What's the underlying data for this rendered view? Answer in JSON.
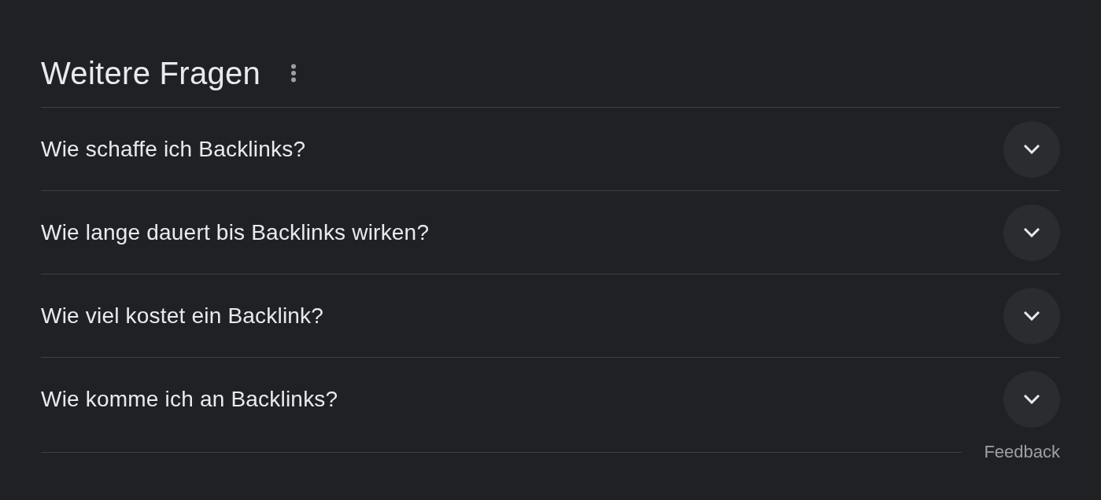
{
  "heading": {
    "title": "Weitere Fragen"
  },
  "questions": [
    {
      "text": "Wie schaffe ich Backlinks?",
      "expanded": false
    },
    {
      "text": "Wie lange dauert bis Backlinks wirken?",
      "expanded": false
    },
    {
      "text": "Wie viel kostet ein Backlink?",
      "expanded": false
    },
    {
      "text": "Wie komme ich an Backlinks?",
      "expanded": false
    }
  ],
  "footer": {
    "link": "Feedback"
  }
}
